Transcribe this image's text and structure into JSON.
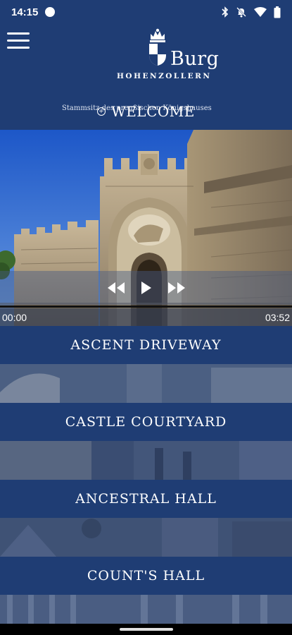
{
  "status_bar": {
    "time": "14:15",
    "icons": [
      "bluetooth-icon",
      "mute-icon",
      "wifi-icon",
      "battery-icon"
    ]
  },
  "header": {
    "menu_icon": "hamburger-menu-icon",
    "logo": {
      "brand": "Burg",
      "name": "HOHENZOLLERN",
      "tagline": "Stammsitz des preußischen Königshauses"
    }
  },
  "welcome": {
    "title": "WELCOME"
  },
  "player": {
    "current_time": "00:00",
    "duration": "03:52",
    "progress": 0,
    "controls": [
      "rewind-icon",
      "play-icon",
      "fast-forward-icon"
    ]
  },
  "tours": [
    {
      "label": "ASCENT DRIVEWAY"
    },
    {
      "label": "CASTLE COURTYARD"
    },
    {
      "label": "ANCESTRAL HALL"
    },
    {
      "label": "COUNT'S HALL"
    }
  ],
  "colors": {
    "brand_blue": "#1f3d74",
    "text": "#ffffff"
  }
}
